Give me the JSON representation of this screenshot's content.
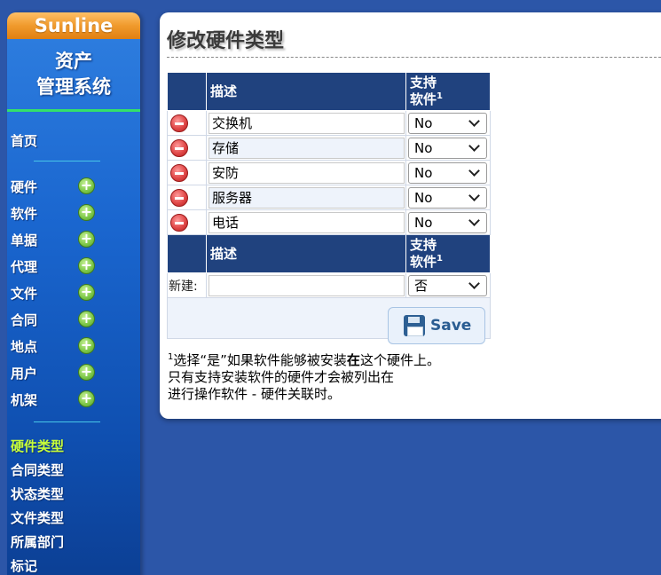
{
  "sidebar": {
    "brand": "Sunline",
    "app_title_line1": "资产",
    "app_title_line2": "管理系统",
    "home": "首页",
    "sections": [
      "硬件",
      "软件",
      "单据",
      "代理",
      "文件",
      "合同",
      "地点",
      "用户",
      "机架"
    ],
    "types": [
      "硬件类型",
      "合同类型",
      "状态类型",
      "文件类型",
      "所属部门",
      "标记"
    ],
    "active_type": "硬件类型",
    "plus_glyph": "+"
  },
  "page": {
    "title": "修改硬件类型"
  },
  "table": {
    "header_desc": "描述",
    "header_support_line1": "支持",
    "header_support_line2": "软件",
    "footnote_mark": "1",
    "rows": [
      {
        "desc": "交换机",
        "support": "No"
      },
      {
        "desc": "存储",
        "support": "No"
      },
      {
        "desc": "安防",
        "support": "No"
      },
      {
        "desc": "服务器",
        "support": "No"
      },
      {
        "desc": "电话",
        "support": "No"
      }
    ],
    "new_label": "新建:",
    "new_desc_value": "",
    "new_support": "否",
    "save_label": "Save"
  },
  "footnote": {
    "mark": "1",
    "line1_a": "选择“是”如果软件能够被安装",
    "line1_bold": "在",
    "line1_b": "这个硬件上。",
    "line2": "只有支持安装软件的硬件才会被列出在",
    "line3": "进行操作软件 - 硬件关联时。"
  }
}
